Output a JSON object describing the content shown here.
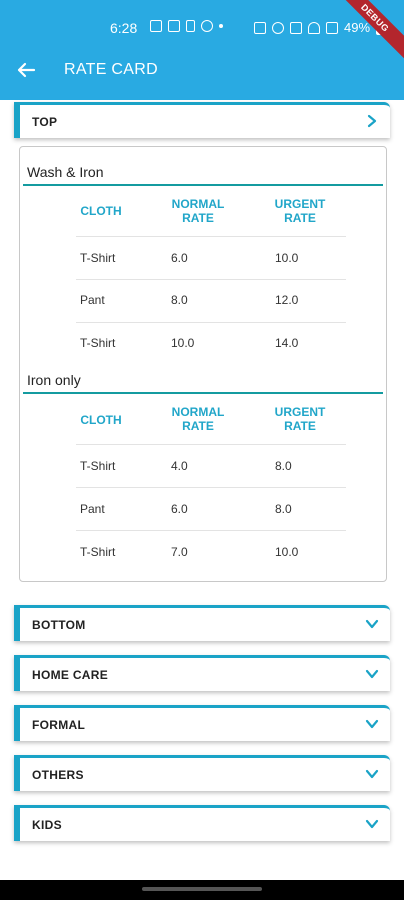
{
  "status_bar": {
    "time": "6:28",
    "battery": "49%",
    "debug_banner": "DEBUG"
  },
  "appbar": {
    "title": "RATE CARD"
  },
  "categories": [
    {
      "label": "TOP",
      "expanded": true
    },
    {
      "label": "BOTTOM",
      "expanded": false
    },
    {
      "label": "HOME CARE",
      "expanded": false
    },
    {
      "label": "FORMAL",
      "expanded": false
    },
    {
      "label": "OTHERS",
      "expanded": false
    },
    {
      "label": "KIDS",
      "expanded": false
    }
  ],
  "rate_sections": [
    {
      "title": "Wash & Iron",
      "headers": [
        "CLOTH",
        "NORMAL RATE",
        "URGENT RATE"
      ],
      "rows": [
        {
          "cloth": "T-Shirt",
          "normal": "6.0",
          "urgent": "10.0"
        },
        {
          "cloth": "Pant",
          "normal": "8.0",
          "urgent": "12.0"
        },
        {
          "cloth": "T-Shirt",
          "normal": "10.0",
          "urgent": "14.0"
        }
      ]
    },
    {
      "title": "Iron only",
      "headers": [
        "CLOTH",
        "NORMAL RATE",
        "URGENT RATE"
      ],
      "rows": [
        {
          "cloth": "T-Shirt",
          "normal": "4.0",
          "urgent": "8.0"
        },
        {
          "cloth": "Pant",
          "normal": "6.0",
          "urgent": "8.0"
        },
        {
          "cloth": "T-Shirt",
          "normal": "7.0",
          "urgent": "10.0"
        }
      ]
    }
  ],
  "colors": {
    "appbar": "#29aae2",
    "accent": "#1aa3c7",
    "section_line": "#149ba0"
  }
}
